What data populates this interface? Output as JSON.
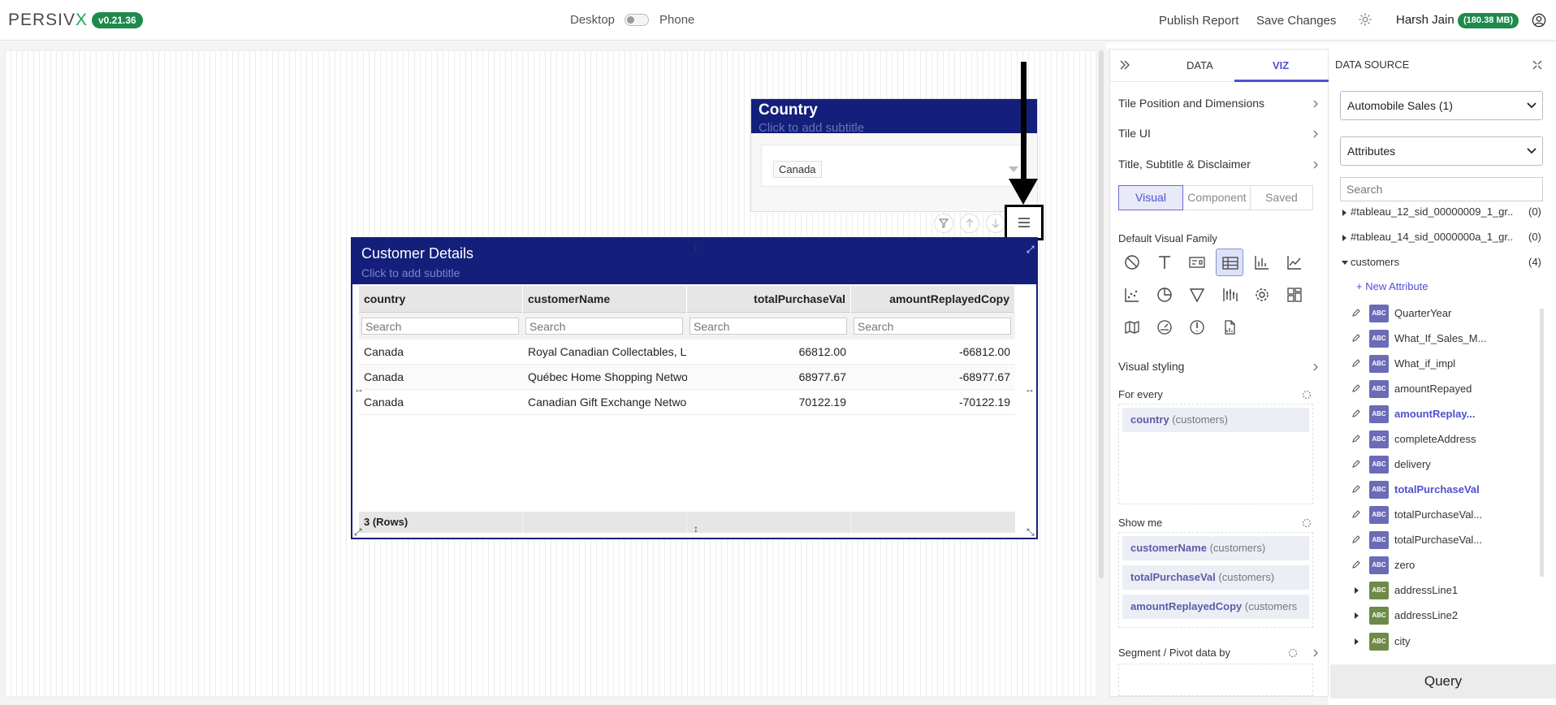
{
  "app": {
    "logo_main": "PERSIV",
    "logo_accent": "X",
    "version": "v0.21.36"
  },
  "header": {
    "desktop_label": "Desktop",
    "phone_label": "Phone",
    "publish_label": "Publish Report",
    "save_label": "Save Changes",
    "user_name": "Harsh Jain",
    "memory_badge": "(180.38 MB)"
  },
  "country_tile": {
    "title": "Country",
    "subtitle": "Click to add subtitle",
    "selected_value": "Canada"
  },
  "customer_tile": {
    "title": "Customer Details",
    "subtitle": "Click to add subtitle",
    "columns": [
      "country",
      "customerName",
      "totalPurchaseVal",
      "amountReplayedCopy"
    ],
    "search_placeholder": "Search",
    "rows": [
      [
        "Canada",
        "Royal Canadian Collectables, Lt",
        "66812.00",
        "-66812.00"
      ],
      [
        "Canada",
        "Québec Home Shopping Networ",
        "68977.67",
        "-68977.67"
      ],
      [
        "Canada",
        "Canadian Gift Exchange Networ",
        "70122.19",
        "-70122.19"
      ]
    ],
    "footer": "3 (Rows)"
  },
  "viz_panel": {
    "tabs": [
      "DATA",
      "VIZ"
    ],
    "sections": [
      "Tile Position and Dimensions",
      "Tile UI",
      "Title, Subtitle & Disclaimer"
    ],
    "mode_buttons": [
      "Visual",
      "Component",
      "Saved"
    ],
    "default_family_label": "Default Visual Family",
    "visual_styling": "Visual styling",
    "for_every_label": "For every",
    "for_every_items": [
      {
        "field": "country",
        "source": "(customers)"
      }
    ],
    "show_me_label": "Show me",
    "show_me_items": [
      {
        "field": "customerName",
        "source": "(customers)"
      },
      {
        "field": "totalPurchaseVal",
        "source": "(customers)"
      },
      {
        "field": "amountReplayedCopy",
        "source": "(customers"
      }
    ],
    "segment_label": "Segment / Pivot data by"
  },
  "data_source": {
    "header": "DATA SOURCE",
    "source_select": "Automobile Sales (1)",
    "type_select": "Attributes",
    "search_placeholder": "Search",
    "tables": [
      {
        "name": "#tableau_12_sid_00000009_1_gr...",
        "count": "(0)"
      },
      {
        "name": "#tableau_14_sid_0000000a_1_gr...",
        "count": "(0)"
      },
      {
        "name": "customers",
        "count": "(4)"
      }
    ],
    "new_attribute": "+ New Attribute",
    "attributes": [
      {
        "badge": "ABC",
        "name": "QuarterYear"
      },
      {
        "badge": "ABC",
        "name": "What_If_Sales_M..."
      },
      {
        "badge": "ABC",
        "name": "What_if_impl"
      },
      {
        "badge": "ABC",
        "name": "amountRepayed"
      },
      {
        "badge": "ABC",
        "name": "amountReplay..."
      },
      {
        "badge": "ABC",
        "name": "completeAddress"
      },
      {
        "badge": "ABC",
        "name": "delivery"
      },
      {
        "badge": "ABC",
        "name": "totalPurchaseVal"
      },
      {
        "badge": "ABC",
        "name": "totalPurchaseVal..."
      },
      {
        "badge": "ABC",
        "name": "totalPurchaseVal..."
      },
      {
        "badge": "ABC",
        "name": "zero"
      },
      {
        "badge": "ABC",
        "name": "addressLine1"
      },
      {
        "badge": "ABC",
        "name": "addressLine2"
      },
      {
        "badge": "ABC",
        "name": "city"
      }
    ],
    "query_label": "Query"
  },
  "colors": {
    "brand_green": "#1e8a4c",
    "tile_header": "#131f7a",
    "accent": "#4f4fd0"
  }
}
